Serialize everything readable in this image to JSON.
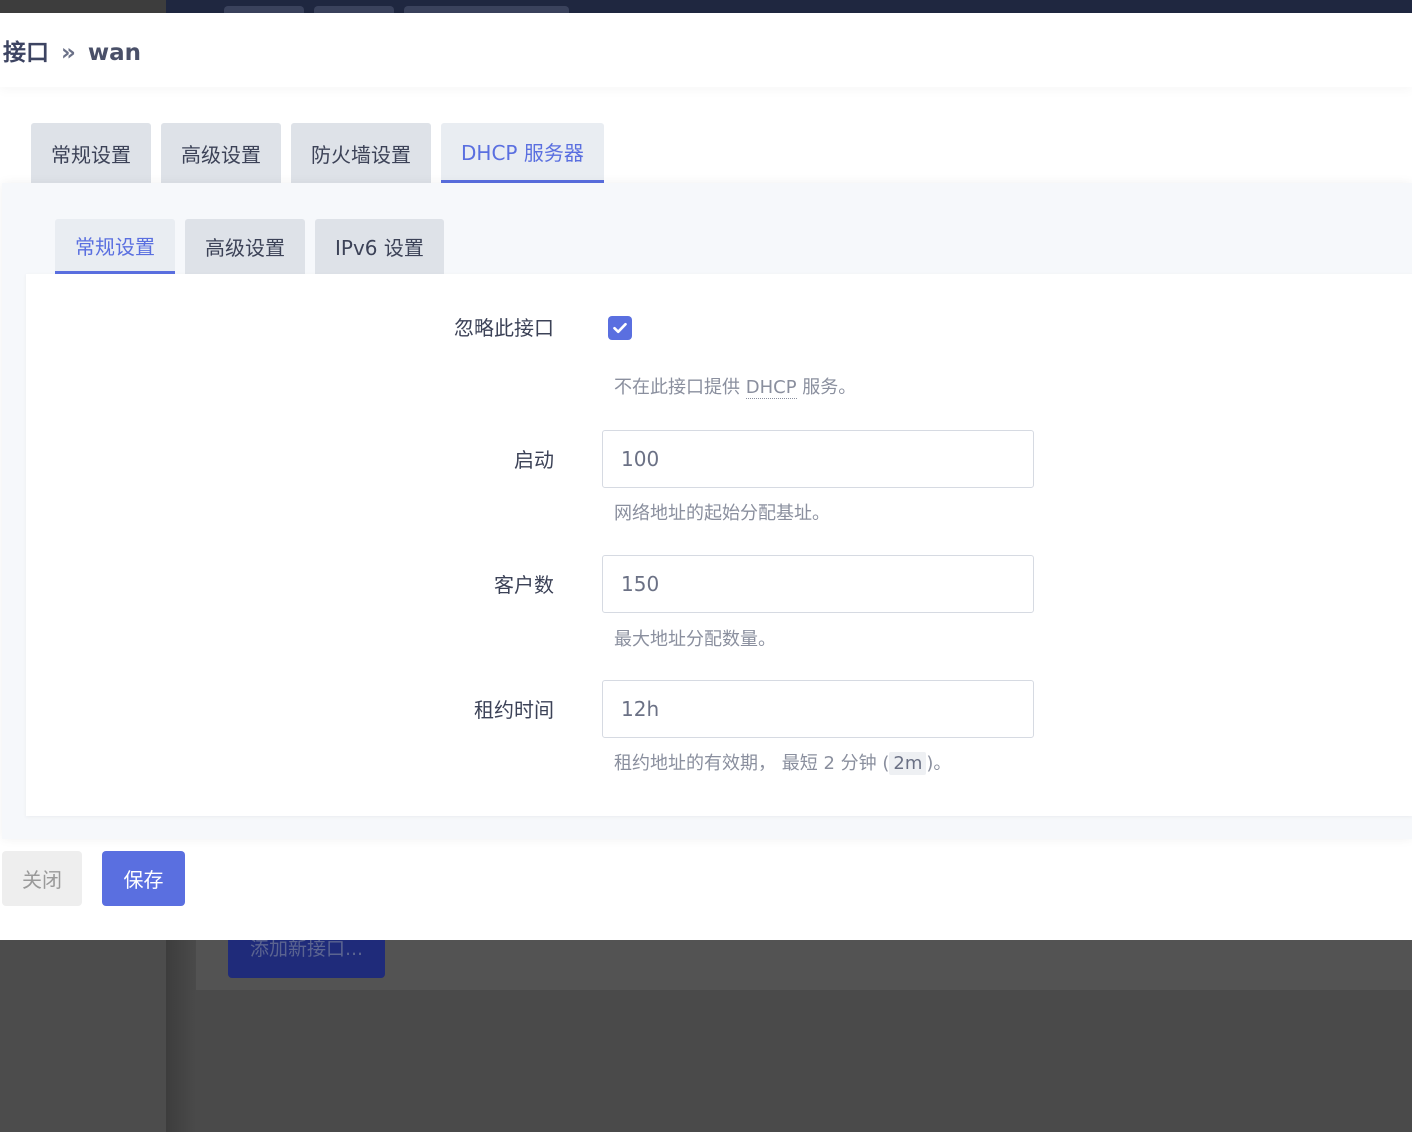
{
  "background": {
    "add_interface_label": "添加新接口..."
  },
  "modal": {
    "title_main": "接口",
    "title_sep": "»",
    "title_iface": "wan",
    "outer_tabs": [
      {
        "label": "常规设置"
      },
      {
        "label": "高级设置"
      },
      {
        "label": "防火墙设置"
      },
      {
        "label": "DHCP 服务器",
        "active": true
      }
    ],
    "inner_tabs": [
      {
        "label": "常规设置",
        "active": true
      },
      {
        "label": "高级设置"
      },
      {
        "label": "IPv6 设置"
      }
    ],
    "fields": {
      "ignore": {
        "label": "忽略此接口",
        "checked": true,
        "desc_before": "不在此接口提供 ",
        "desc_abbr": "DHCP",
        "desc_after": " 服务。"
      },
      "start": {
        "label": "启动",
        "value": "100",
        "desc": "网络地址的起始分配基址。"
      },
      "limit": {
        "label": "客户数",
        "value": "150",
        "desc": "最大地址分配数量。"
      },
      "leasetime": {
        "label": "租约时间",
        "value": "12h",
        "desc_before": "租约地址的有效期， 最短 2 分钟 (",
        "desc_code": "2m",
        "desc_after": ")。"
      }
    },
    "buttons": {
      "close": "关闭",
      "save": "保存"
    }
  },
  "colors": {
    "accent": "#5a6fe0",
    "topbar": "#1f2740",
    "overlay": "#4a4a4a"
  }
}
